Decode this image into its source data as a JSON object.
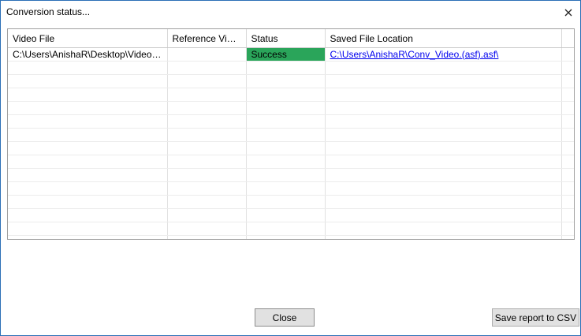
{
  "window": {
    "title": "Conversion status...",
    "close_icon": "close-icon"
  },
  "grid": {
    "columns": [
      "Video File",
      "Reference Video...",
      "Status",
      "Saved File Location",
      ""
    ],
    "rows": [
      {
        "video_file": "C:\\Users\\AnishaR\\Desktop\\Video.(asf).asf",
        "reference_video": "",
        "status": "Success",
        "saved_location": "C:\\Users\\AnishaR\\Conv_Video.(asf).asf\\"
      }
    ],
    "status_color": "#2aa55a",
    "link_color": "#0000ee"
  },
  "buttons": {
    "close_label": "Close",
    "save_label": "Save report to CSV"
  }
}
